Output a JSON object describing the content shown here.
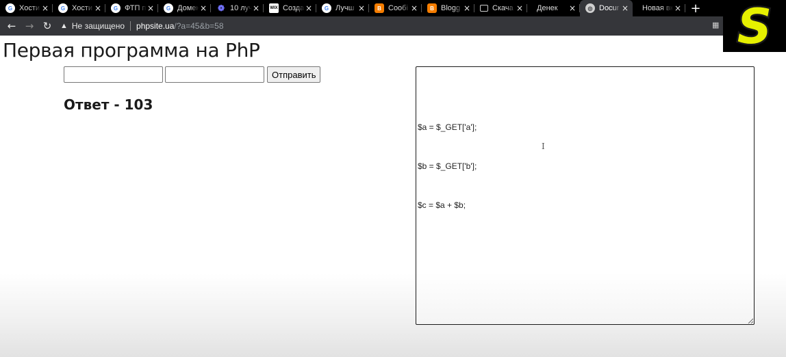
{
  "browser": {
    "tabs": [
      {
        "icon": "google-icon",
        "title": "Хости"
      },
      {
        "icon": "google-icon",
        "title": "Хости"
      },
      {
        "icon": "google-icon",
        "title": "ФТП п"
      },
      {
        "icon": "google-icon",
        "title": "Домен"
      },
      {
        "icon": "blue-swirl-icon",
        "title": "10 луч"
      },
      {
        "icon": "wix-icon",
        "title": "Созда"
      },
      {
        "icon": "google-icon",
        "title": "Лучш"
      },
      {
        "icon": "blogger-icon",
        "title": "Сообі"
      },
      {
        "icon": "blogger-icon",
        "title": "Blogg"
      },
      {
        "icon": "window-icon",
        "title": "Скача"
      },
      {
        "icon": "none",
        "title": "Денек"
      },
      {
        "icon": "globe-icon",
        "title": "Docur",
        "active": true
      },
      {
        "icon": "none",
        "title": "Новая вкл"
      }
    ],
    "new_tab_label": "+",
    "close_glyph": "×",
    "security_label": "Не защищено",
    "url_host": "phpsite.ua",
    "url_path": "/?a=45&b=58"
  },
  "page": {
    "title": "Первая программа на PhP",
    "form": {
      "input_a_value": "",
      "input_b_value": "",
      "submit_label": "Отправить"
    },
    "answer": "Ответ - 103",
    "code_lines": [
      "$a = $_GET['a'];",
      "$b = $_GET['b'];",
      "$c = $a + $b;"
    ]
  },
  "logo": {
    "letter": "S",
    "fill_color": "#e6f000",
    "outline_color": "#1a1a1a"
  }
}
